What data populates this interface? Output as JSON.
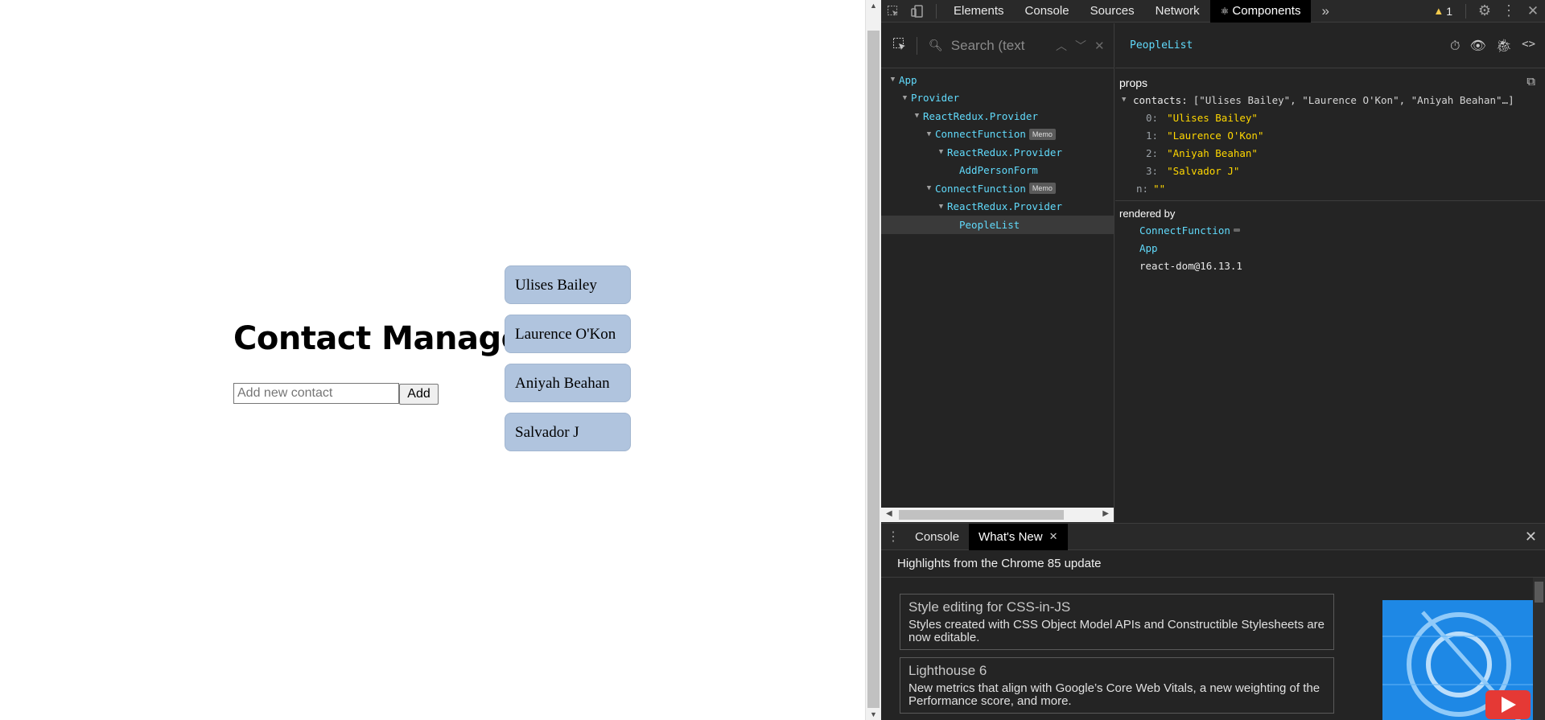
{
  "app": {
    "title": "Contact Manager",
    "input_placeholder": "Add new contact",
    "add_label": "Add",
    "contacts": [
      "Ulises Bailey",
      "Laurence O'Kon",
      "Aniyah Beahan",
      "Salvador J"
    ]
  },
  "devtools": {
    "tabs": [
      "Elements",
      "Console",
      "Sources",
      "Network",
      "Components"
    ],
    "active_tab": "Components",
    "components_tab_icon": "⚛",
    "more_tabs": "»",
    "warning_count": "1",
    "search_placeholder": "Search (text",
    "tree": [
      {
        "label": "App",
        "badge": ""
      },
      {
        "label": "Provider",
        "badge": ""
      },
      {
        "label": "ReactRedux.Provider",
        "badge": ""
      },
      {
        "label": "ConnectFunction",
        "badge": "Memo"
      },
      {
        "label": "ReactRedux.Provider",
        "badge": ""
      },
      {
        "label": "AddPersonForm",
        "badge": ""
      },
      {
        "label": "ConnectFunction",
        "badge": "Memo"
      },
      {
        "label": "ReactRedux.Provider",
        "badge": ""
      },
      {
        "label": "PeopleList",
        "badge": ""
      }
    ],
    "selected_component": "PeopleList",
    "props_title": "props",
    "contacts_key": "contacts:",
    "contacts_summary": "[\"Ulises Bailey\", \"Laurence O'Kon\", \"Aniyah Beahan\"…]",
    "contacts_items": [
      {
        "index": "0:",
        "value": "\"Ulises Bailey\""
      },
      {
        "index": "1:",
        "value": "\"Laurence O'Kon\""
      },
      {
        "index": "2:",
        "value": "\"Aniyah Beahan\""
      },
      {
        "index": "3:",
        "value": "\"Salvador J\""
      }
    ],
    "new_prop_key": "n:",
    "new_prop_value": "\"\"",
    "rendered_by_title": "rendered by",
    "rendered_by": [
      "ConnectFunction",
      "App",
      "react-dom@16.13.1"
    ],
    "drawer": {
      "tabs": [
        "Console",
        "What's New"
      ],
      "active_tab": "What's New",
      "highlights": "Highlights from the Chrome 85 update",
      "features": [
        {
          "title": "Style editing for CSS-in-JS",
          "desc": "Styles created with CSS Object Model APIs and Constructible Stylesheets are now editable."
        },
        {
          "title": "Lighthouse 6",
          "desc": "New metrics that align with Google’s Core Web Vitals, a new weighting of the Performance score, and more."
        }
      ]
    }
  },
  "colors": {
    "card_bg": "#b0c4de",
    "component_name": "#61dafb",
    "string_value": "#ffd700",
    "devtools_bg": "#242424",
    "warning": "#f2c94c"
  }
}
